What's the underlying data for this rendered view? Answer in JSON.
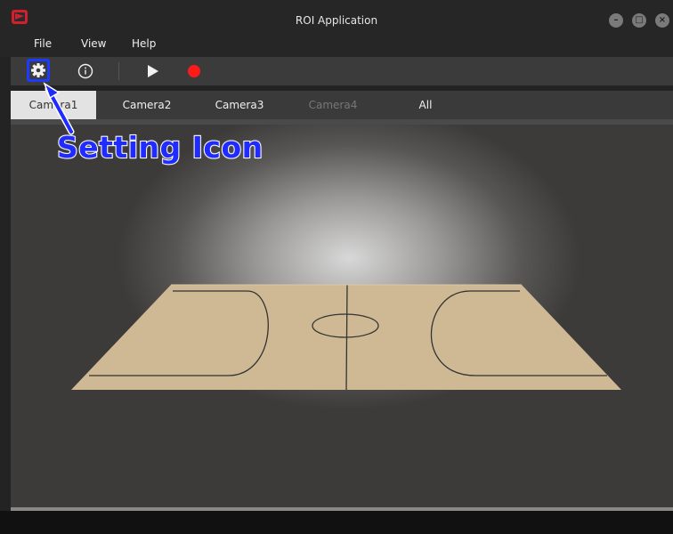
{
  "window": {
    "title": "ROI Application",
    "controls": [
      "minimize",
      "maximize",
      "close"
    ]
  },
  "menu": {
    "items": [
      "File",
      "View",
      "Help"
    ]
  },
  "toolbar": {
    "buttons": [
      {
        "name": "settings",
        "icon": "gear-icon"
      },
      {
        "name": "info",
        "icon": "info-icon"
      },
      {
        "name": "play",
        "icon": "play-icon"
      },
      {
        "name": "record",
        "icon": "record-icon",
        "color": "#ff1a1a"
      }
    ]
  },
  "tabs": {
    "items": [
      {
        "label": "Camera1",
        "state": "active"
      },
      {
        "label": "Camera2",
        "state": "normal"
      },
      {
        "label": "Camera3",
        "state": "normal"
      },
      {
        "label": "Camera4",
        "state": "disabled"
      },
      {
        "label": "All",
        "state": "normal"
      }
    ]
  },
  "annotation": {
    "label": "Setting Icon",
    "color": "#1f2bff"
  },
  "viewport": {
    "scene": "basketball-court",
    "court_color": "#cfb995"
  }
}
